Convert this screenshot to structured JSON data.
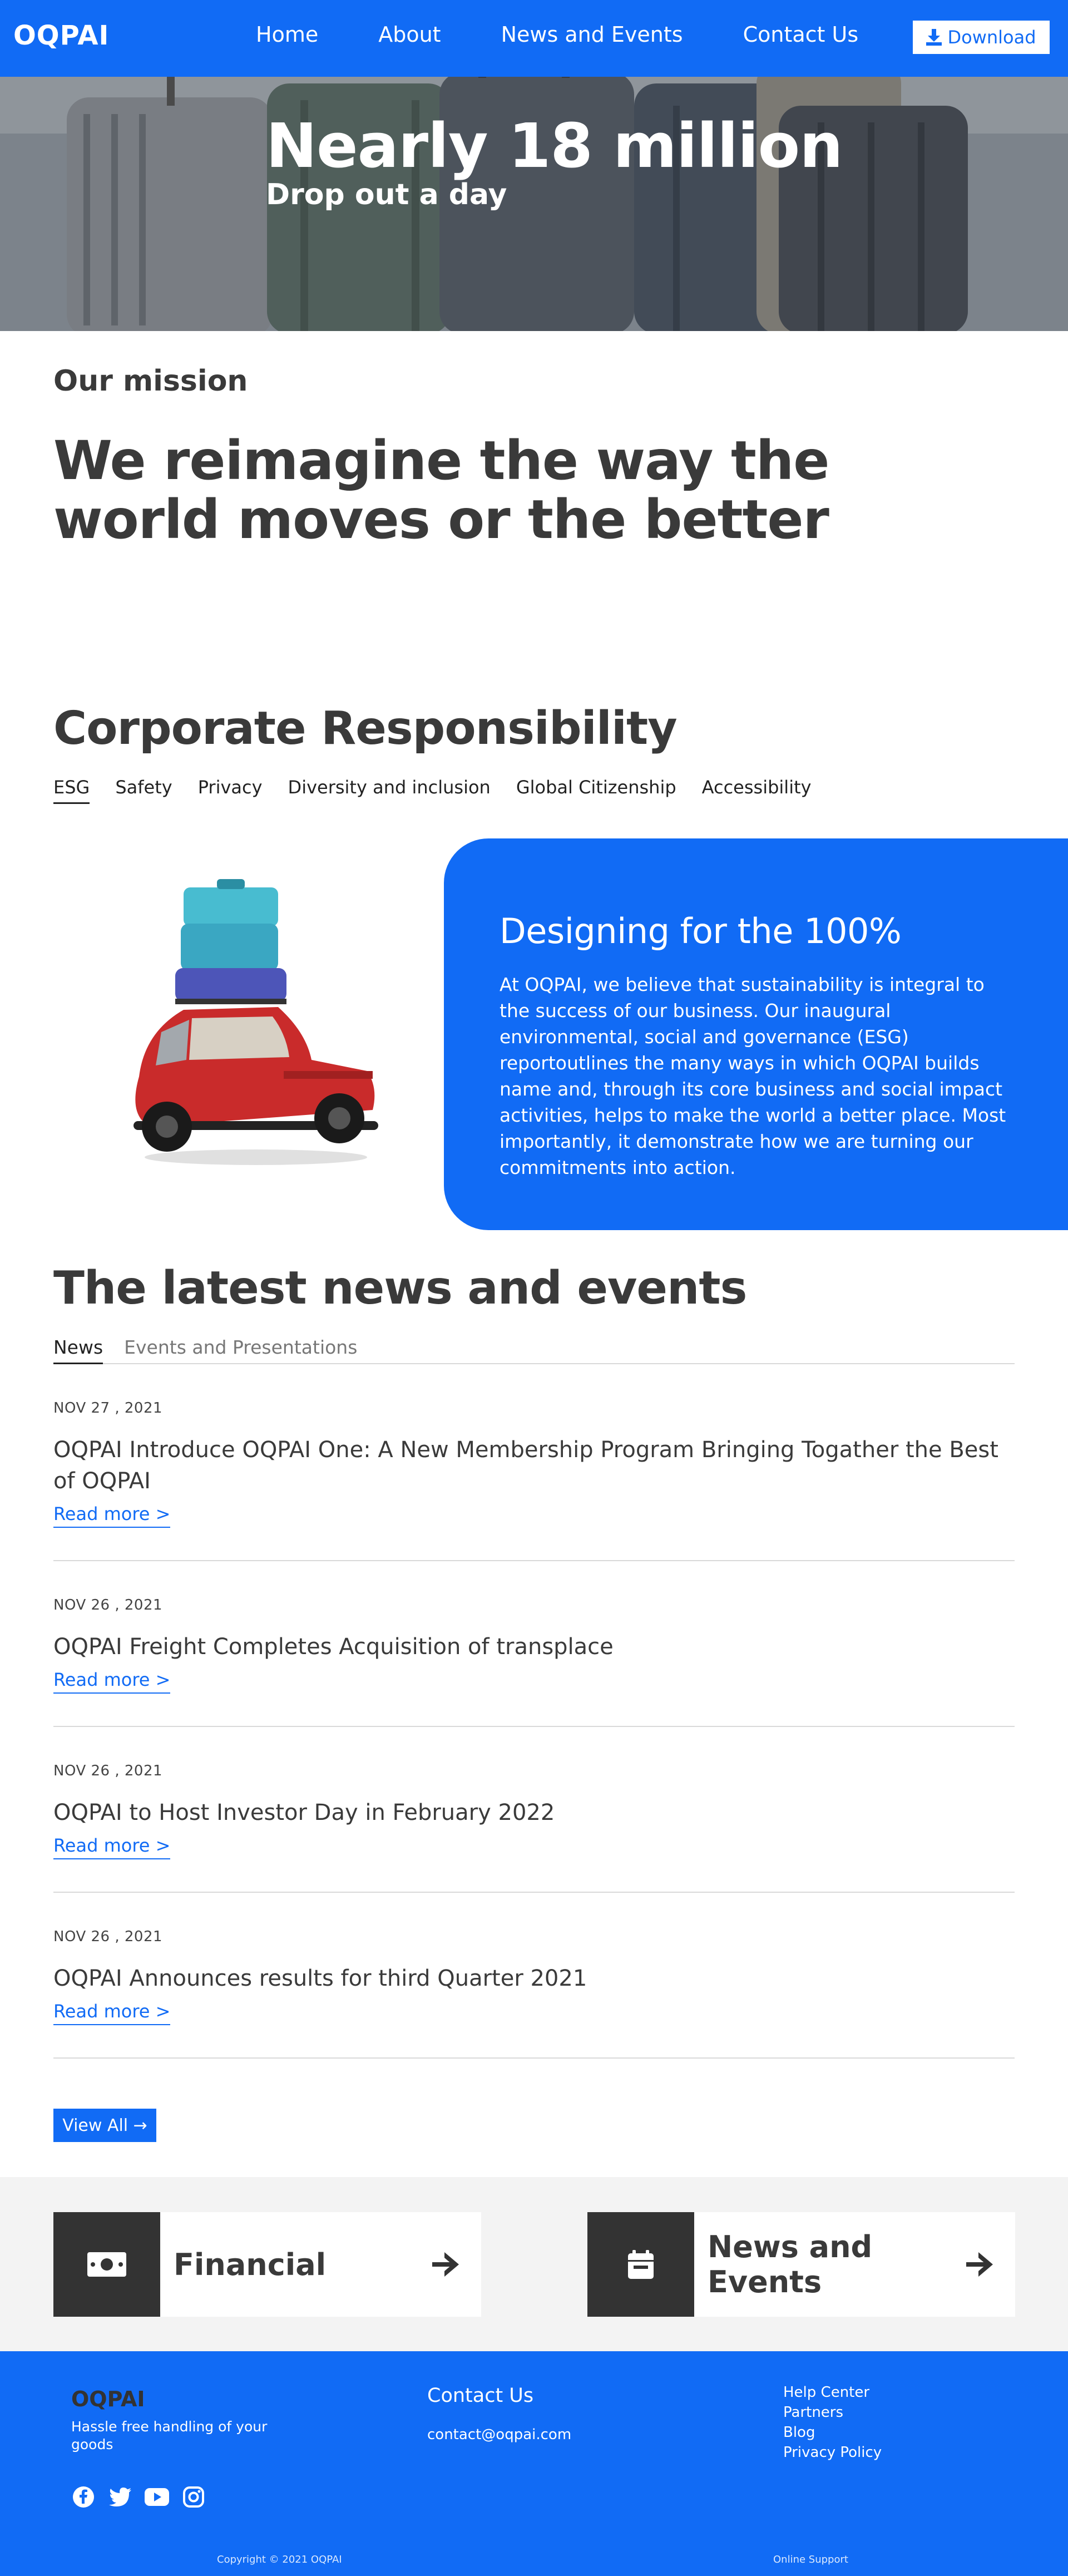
{
  "nav": {
    "logo": "OQPAI",
    "menu": [
      "Home",
      "About",
      "News and Events",
      "Contact Us"
    ],
    "download_label": "Download"
  },
  "hero": {
    "title": "Nearly 18 million",
    "subtitle": "Drop out a day"
  },
  "mission": {
    "label": "Our mission",
    "text": "We reimagine the way the world moves or the better"
  },
  "corporate": {
    "title": "Corporate Responsibility",
    "tabs": [
      "ESG",
      "Safety",
      "Privacy",
      "Diversity and inclusion",
      "Global Citizenship",
      "Accessibility"
    ],
    "active_tab": "ESG",
    "card_title": "Designing for the 100%",
    "card_text": "At OQPAI, we believe that sustainability is integral to the success of our business. Our inaugural environmental, social and governance (ESG) reportoutlines the many ways in which OQPAI builds name and, through its core business and social impact activities, helps to make the world a better place. Most importantly, it demonstrate how we are turning our commitments into action."
  },
  "news": {
    "title": "The latest news and events",
    "tabs": [
      "News",
      "Events and Presentations"
    ],
    "active_tab": "News",
    "items": [
      {
        "date": "NOV 27 , 2021",
        "headline": "OQPAI Introduce OQPAI One: A New Membership Program Bringing Togather the Best of OQPAI",
        "link": "Read more >"
      },
      {
        "date": "NOV 26 , 2021",
        "headline": "OQPAI Freight Completes Acquisition of transplace",
        "link": "Read more >"
      },
      {
        "date": "NOV 26 , 2021",
        "headline": "OQPAI to Host Investor Day in February 2022",
        "link": "Read more >"
      },
      {
        "date": "NOV 26 , 2021",
        "headline": "OQPAI Announces results for third Quarter 2021",
        "link": "Read more >"
      }
    ],
    "view_all": "View All →"
  },
  "cards": [
    {
      "label": "Financial",
      "icon": "money-bill-icon"
    },
    {
      "label": "News and Events",
      "icon": "calendar-icon"
    }
  ],
  "footer": {
    "logo": "OQPAI",
    "tagline": "Hassle free handling of your goods",
    "contact_title": "Contact Us",
    "contact_email": "contact@oqpai.com",
    "links": [
      "Help Center",
      "Partners",
      "Blog",
      "Privacy Policy"
    ],
    "socials": [
      "facebook-icon",
      "twitter-icon",
      "youtube-icon",
      "instagram-icon"
    ],
    "copyright": "Copyright © 2021 OQPAI",
    "support": "Online Support"
  },
  "colors": {
    "accent": "#116bf5",
    "text": "#3a3a3a",
    "card_dark": "#333333",
    "band": "#f3f3f3"
  }
}
